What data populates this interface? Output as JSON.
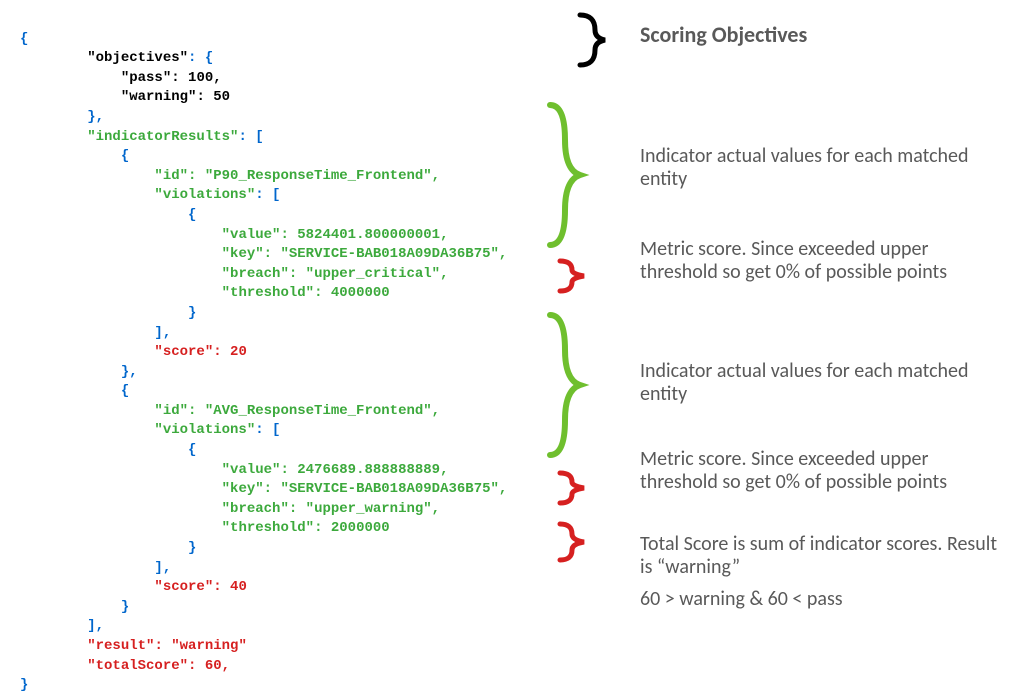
{
  "code": {
    "open": "{",
    "objectives_key": "\"objectives\"",
    "objectives_open": ": {",
    "pass_key": "\"pass\"",
    "pass_val": ": 100,",
    "warning_key": "\"warning\"",
    "warning_val": ": 50",
    "close_brace": "},",
    "indicatorResults_key": "\"indicatorResults\"",
    "indicatorResults_open": ": [",
    "arr_open": "{",
    "arr_close": "}",
    "arr_close_comma": "},",
    "id_key": "\"id\"",
    "id1_val": ": \"P90_ResponseTime_Frontend\",",
    "violations_key": "\"violations\"",
    "violations_open": ": [",
    "value_key": "\"value\"",
    "value1_val": ": 5824401.800000001,",
    "key_key": "\"key\"",
    "key1_val": ": \"SERVICE-BAB018A09DA36B75\",",
    "breach_key": "\"breach\"",
    "breach1_val": ": \"upper_critical\",",
    "threshold_key": "\"threshold\"",
    "threshold1_val": ": 4000000",
    "arr_bracket_close": "],",
    "score_key": "\"score\"",
    "score1_val": ": 20",
    "id2_val": ": \"AVG_ResponseTime_Frontend\",",
    "value2_val": ": 2476689.888888889,",
    "key2_val": ": \"SERVICE-BAB018A09DA36B75\",",
    "breach2_val": ": \"upper_warning\",",
    "threshold2_val": ": 2000000",
    "score2_val": ": 40",
    "final_bracket_close": "],",
    "result_key": "\"result\"",
    "result_val": ": \"warning\"",
    "totalScore_key": "\"totalScore\"",
    "totalScore_val": ": 60,",
    "close": "}"
  },
  "annotations": {
    "a1": "Scoring Objectives",
    "a2": "Indicator actual values for each matched entity",
    "a3": "Metric score.  Since exceeded upper threshold so get 0% of possible points",
    "a4": "Indicator actual values for each matched entity",
    "a5": "Metric score.  Since exceeded upper threshold so get 0% of possible points",
    "a6": "Total Score is sum of indicator scores.  Result is “warning”",
    "a7": "60 > warning & 60 < pass"
  }
}
